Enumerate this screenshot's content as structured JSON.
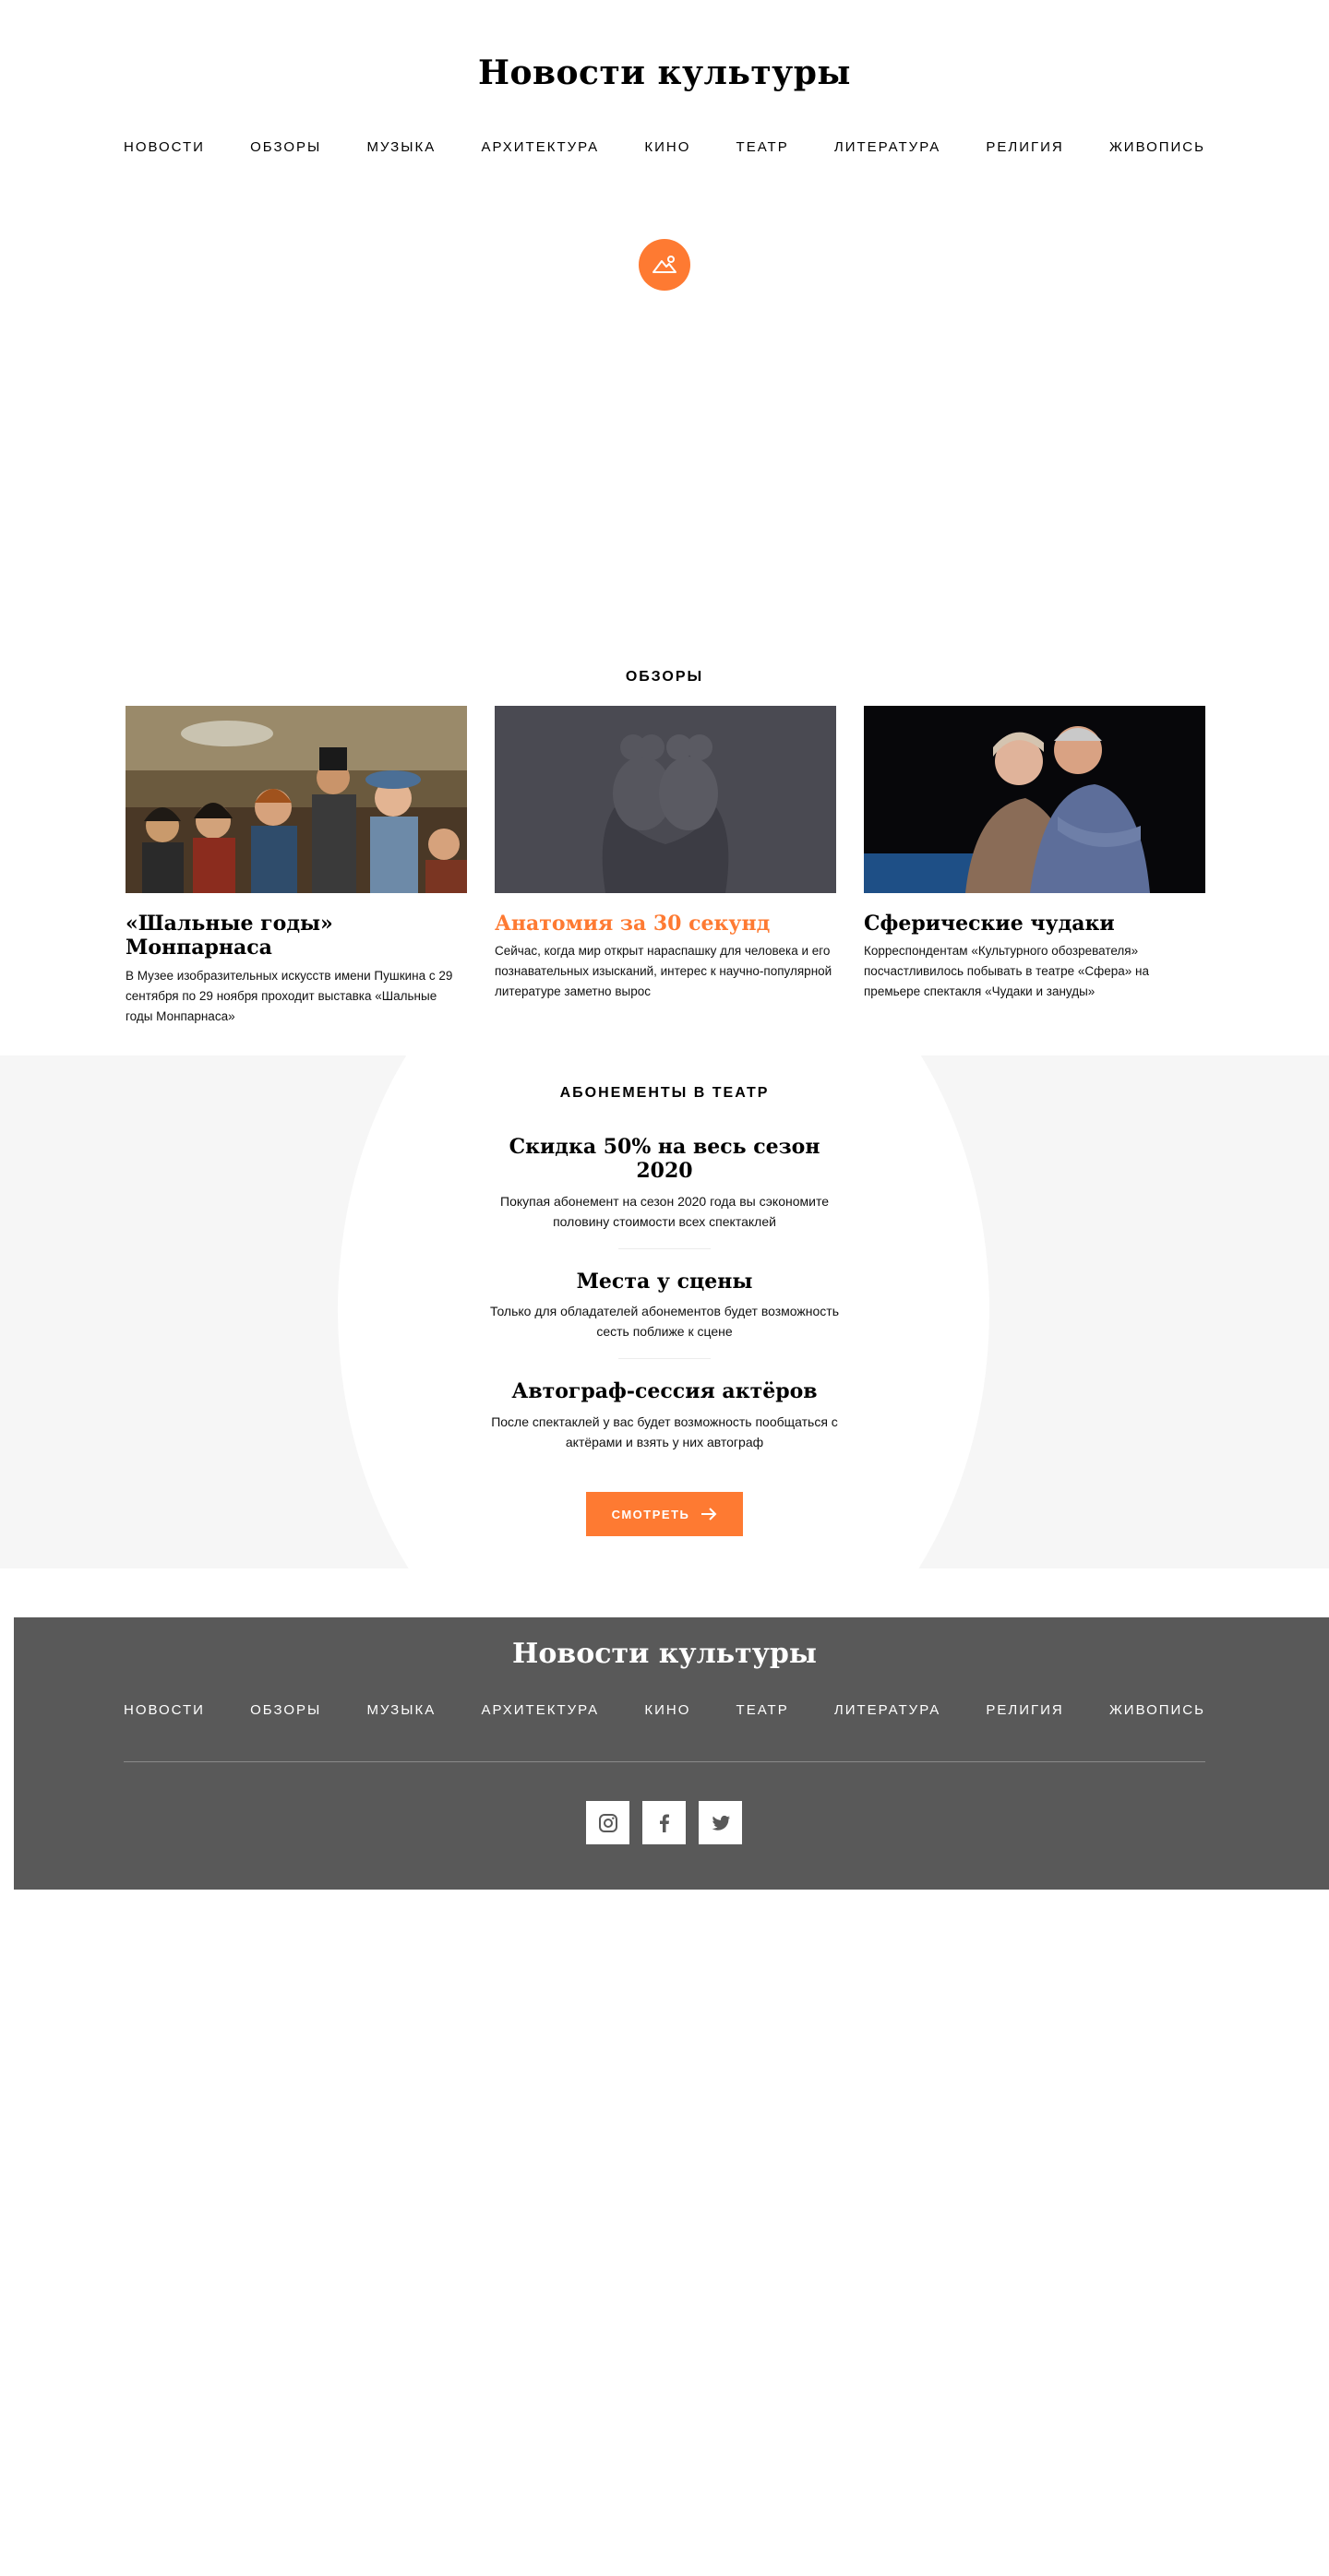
{
  "header": {
    "site_title": "Новости культуры",
    "nav": [
      "НОВОСТИ",
      "ОБЗОРЫ",
      "МУЗЫКА",
      "АРХИТЕКТУРА",
      "КИНО",
      "ТЕАТР",
      "ЛИТЕРАТУРА",
      "РЕЛИГИЯ",
      "ЖИВОПИСЬ"
    ]
  },
  "hero": {
    "icon": "image-placeholder-icon"
  },
  "reviews": {
    "heading": "ОБЗОРЫ",
    "cards": [
      {
        "title": "«Шальные годы» Монпарнаса",
        "text": "В Музее изобразительных искусств имени Пушкина с 29 сентября по 29 ноября проходит выставка «Шальные годы Монпарнаса»",
        "image": "painting-people-thumbnail"
      },
      {
        "title": "Анатомия за 30 секунд",
        "text": "Сейчас, когда мир открыт нараспашку для человека и его познавательных изысканий, интерес к научно-популярной литературе заметно вырос",
        "image": "hands-sculpture-thumbnail"
      },
      {
        "title": "Сферические чудаки",
        "text": "Корреспондентам «Культурного обозревателя» посчастливилось побывать в театре «Сфера» на премьере спектакля «Чудаки и зануды»",
        "image": "theatre-actors-thumbnail"
      }
    ]
  },
  "subscriptions": {
    "heading": "АБОНЕМЕНТЫ В ТЕАТР",
    "offers": [
      {
        "title": "Скидка 50% на весь сезон 2020",
        "text": "Покупая абонемент на сезон 2020 года вы сэкономите половину стоимости всех спектаклей"
      },
      {
        "title": "Места у сцены",
        "text": "Только для обладателей абонементов будет возможность сесть поближе к сцене"
      },
      {
        "title": "Автограф-сессия актёров",
        "text": "После спектаклей у вас будет возможность пообщаться с актёрами и взять у них автограф"
      }
    ],
    "button_label": "СМОТРЕТЬ"
  },
  "footer": {
    "site_title": "Новости культуры",
    "nav": [
      "НОВОСТИ",
      "ОБЗОРЫ",
      "МУЗЫКА",
      "АРХИТЕКТУРА",
      "КИНО",
      "ТЕАТР",
      "ЛИТЕРАТУРА",
      "РЕЛИГИЯ",
      "ЖИВОПИСЬ"
    ],
    "socials": [
      "instagram-icon",
      "facebook-icon",
      "twitter-icon"
    ]
  },
  "colors": {
    "accent": "#fe7a32",
    "footer_bg": "#595959",
    "section_bg": "#f6f6f6"
  }
}
